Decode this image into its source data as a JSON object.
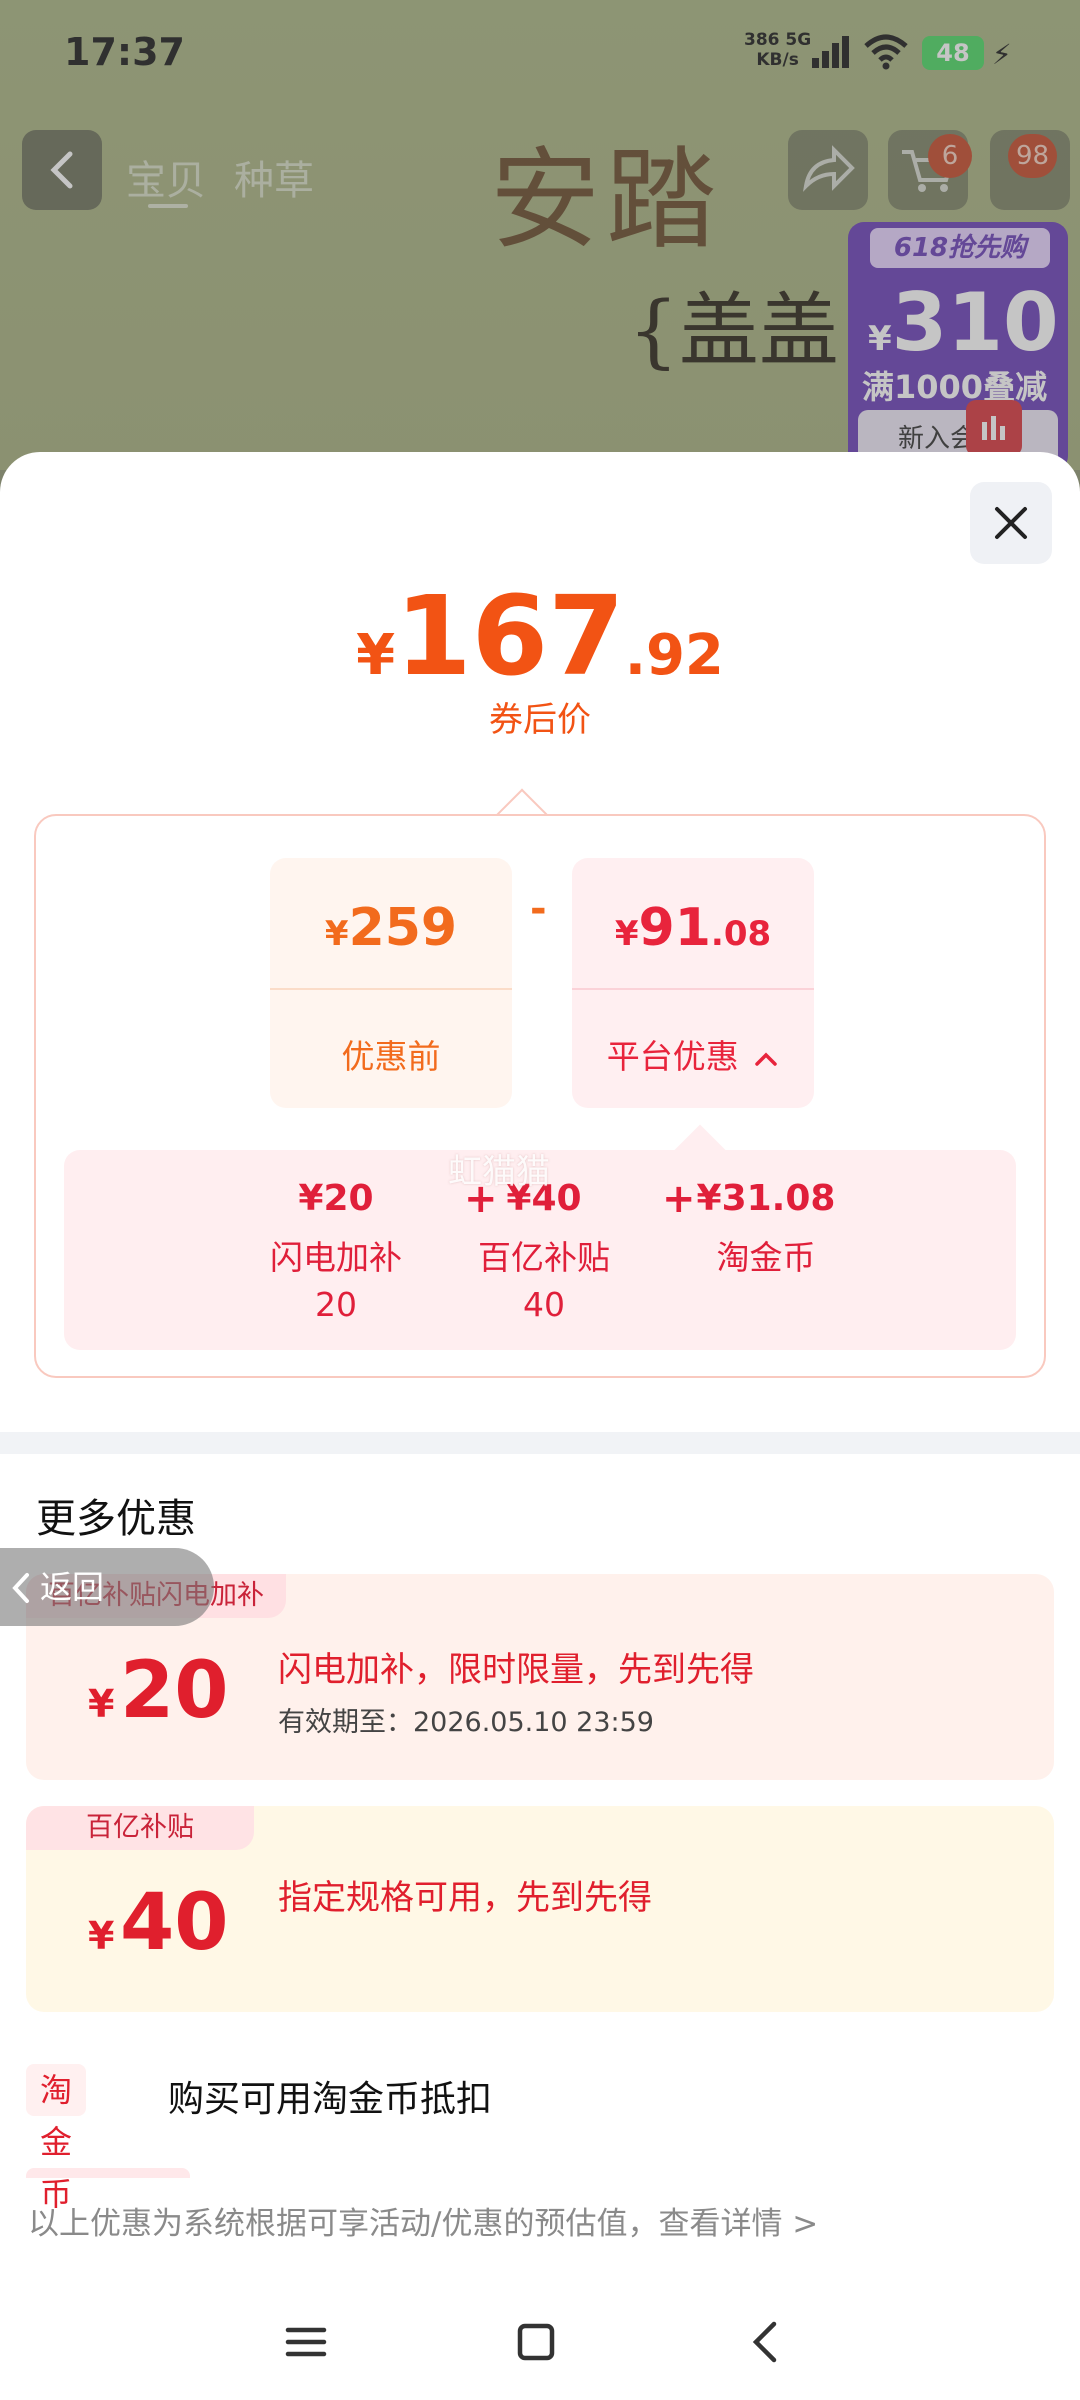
{
  "status_bar": {
    "time": "17:37",
    "net_speed_value": "386",
    "net_speed_unit": "KB/s",
    "network": "5G",
    "battery": "48"
  },
  "product_header": {
    "tabs": [
      "宝贝",
      "种草"
    ],
    "cart_badge": "6",
    "more_badge": "98"
  },
  "banner": {
    "brand_title": "安踏",
    "brand_sub": "{盖盖}",
    "promo_tag": "618抢先购",
    "promo_currency": "¥",
    "promo_amount": "310",
    "promo_line": "满1000叠减",
    "promo_new": "新入会"
  },
  "sheet": {
    "final_price": {
      "currency": "¥",
      "integer": "167",
      "decimal": ".92"
    },
    "final_caption": "券后价",
    "original": {
      "currency": "¥",
      "integer": "259",
      "label": "优惠前"
    },
    "minus": "-",
    "platform": {
      "currency": "¥",
      "integer": "91",
      "decimal": ".08",
      "label": "平台优惠"
    },
    "watermark": "虹猫猫",
    "sub_discounts": [
      {
        "amount": "¥20",
        "name": "闪电加补",
        "count": "20"
      },
      {
        "amount": "¥40",
        "name": "百亿补贴",
        "count": "40"
      },
      {
        "amount": "¥31.08",
        "name": "淘金币",
        "count": ""
      }
    ],
    "plus": "+",
    "more_title": "更多优惠",
    "coupons": [
      {
        "tag": "百亿补贴闪电加补",
        "currency": "¥",
        "value": "20",
        "desc": "闪电加补，限时限量，先到先得",
        "expiry": "有效期至：2026.05.10 23:59"
      },
      {
        "tag": "百亿补贴",
        "currency": "¥",
        "value": "40",
        "desc": "指定规格可用，先到先得",
        "expiry": ""
      }
    ],
    "coin_tag": "淘金币",
    "coin_text": "购买可用淘金币抵扣",
    "footer_note": "以上优惠为系统根据可享活动/优惠的预估值，查看详情 >",
    "floating_back": "返回"
  },
  "colors": {
    "accent_orange": "#f25314",
    "accent_red": "#e01f2d",
    "battery_green": "#4cd964"
  }
}
